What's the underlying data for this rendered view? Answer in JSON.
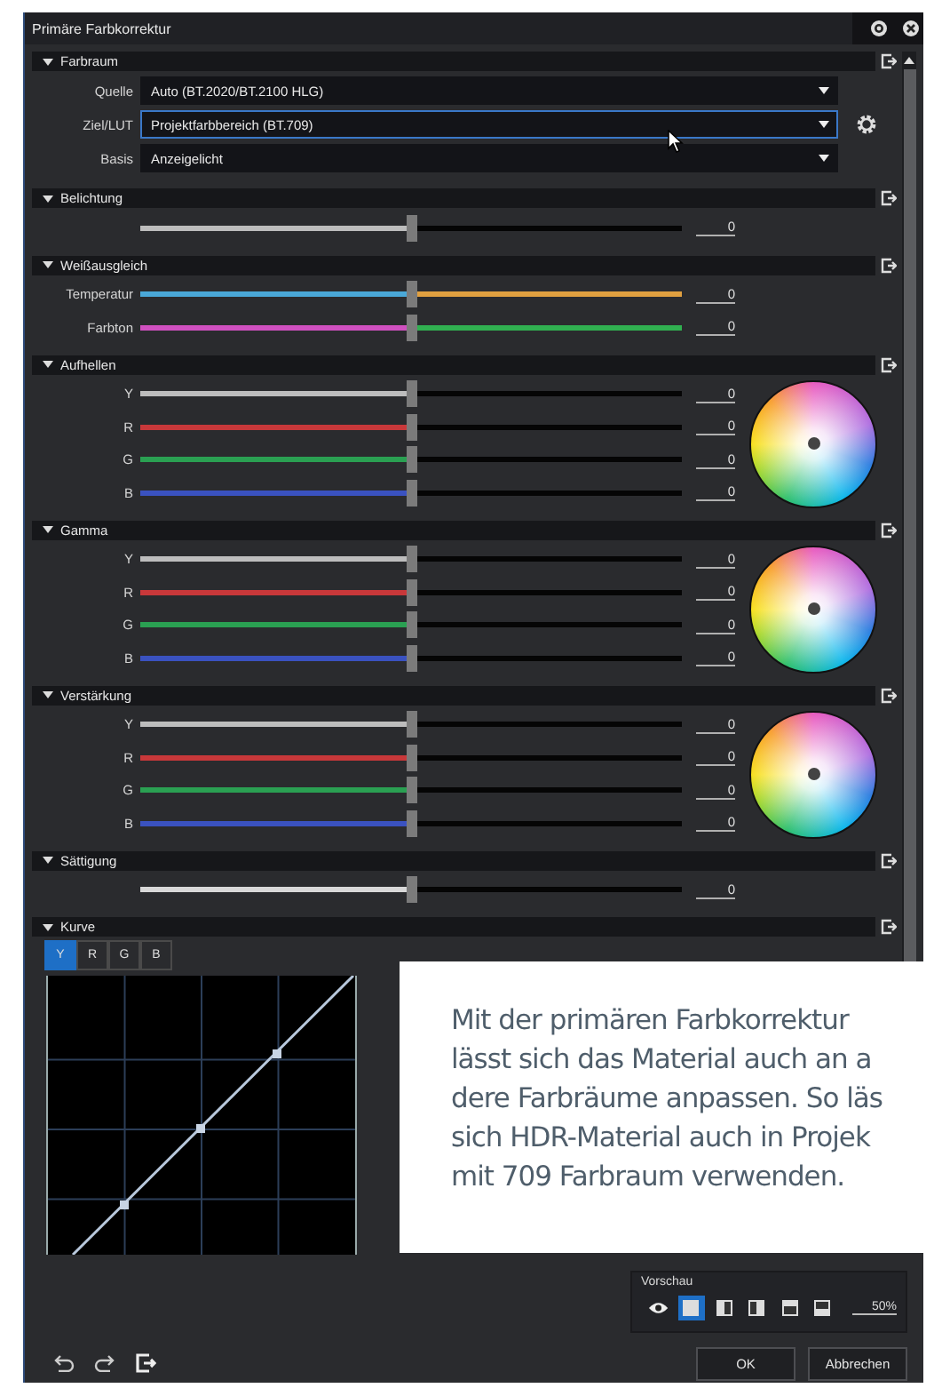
{
  "window": {
    "title": "Primäre Farbkorrektur"
  },
  "sections": [
    {
      "kind": "colorspace",
      "title": "Farbraum",
      "expanded": true,
      "fields": [
        {
          "label": "Quelle",
          "value": "Auto (BT.2020/BT.2100 HLG)",
          "focused": false,
          "settings_button": false
        },
        {
          "label": "Ziel/LUT",
          "value": "Projektfarbbereich (BT.709)",
          "focused": true,
          "settings_button": true
        },
        {
          "label": "Basis",
          "value": "Anzeigelicht",
          "focused": false,
          "settings_button": false
        }
      ]
    },
    {
      "kind": "sliders",
      "title": "Belichtung",
      "expanded": true,
      "wheel": false,
      "sliders": [
        {
          "color": "#bdbdbd",
          "level": 0.5,
          "value": "0"
        }
      ]
    },
    {
      "kind": "sliders",
      "title": "Weißausgleich",
      "expanded": true,
      "wheel": false,
      "sliders": [
        {
          "label": "Temperatur",
          "color": "#4aa8d8",
          "rail": {
            "color": "#e0a040"
          },
          "level": 0.5,
          "value": "0"
        },
        {
          "label": "Farbton",
          "color": "#d050c0",
          "rail": {
            "color": "#30b050"
          },
          "level": 0.5,
          "value": "0"
        }
      ]
    },
    {
      "kind": "sliders",
      "title": "Aufhellen",
      "expanded": true,
      "wheel": true,
      "sliders": [
        {
          "label": "Y",
          "color": "#bdbdbd",
          "level": 0.5,
          "value": "0"
        },
        {
          "label": "R",
          "color": "#c8383a",
          "level": 0.5,
          "value": "0"
        },
        {
          "label": "G",
          "color": "#2aa052",
          "level": 0.5,
          "value": "0"
        },
        {
          "label": "B",
          "color": "#3a52c0",
          "level": 0.5,
          "value": "0"
        }
      ]
    },
    {
      "kind": "sliders",
      "title": "Gamma",
      "expanded": true,
      "wheel": true,
      "sliders": [
        {
          "label": "Y",
          "color": "#bdbdbd",
          "level": 0.5,
          "value": "0"
        },
        {
          "label": "R",
          "color": "#c8383a",
          "level": 0.5,
          "value": "0"
        },
        {
          "label": "G",
          "color": "#2aa052",
          "level": 0.5,
          "value": "0"
        },
        {
          "label": "B",
          "color": "#3a52c0",
          "level": 0.5,
          "value": "0"
        }
      ]
    },
    {
      "kind": "sliders",
      "title": "Verstärkung",
      "expanded": true,
      "wheel": true,
      "sliders": [
        {
          "label": "Y",
          "color": "#bdbdbd",
          "level": 0.5,
          "value": "0"
        },
        {
          "label": "R",
          "color": "#c8383a",
          "level": 0.5,
          "value": "0"
        },
        {
          "label": "G",
          "color": "#2aa052",
          "level": 0.5,
          "value": "0"
        },
        {
          "label": "B",
          "color": "#3a52c0",
          "level": 0.5,
          "value": "0"
        }
      ]
    },
    {
      "kind": "sliders",
      "title": "Sättigung",
      "expanded": true,
      "wheel": false,
      "sliders": [
        {
          "color": "#d8d8d8",
          "level": 0.5,
          "value": "0"
        }
      ]
    },
    {
      "kind": "curve",
      "title": "Kurve",
      "expanded": true,
      "channels": [
        {
          "label": "Y",
          "selected": true
        },
        {
          "label": "R",
          "selected": false
        },
        {
          "label": "G",
          "selected": false
        },
        {
          "label": "B",
          "selected": false
        }
      ]
    }
  ],
  "preview": {
    "label": "Vorschau",
    "modes": [
      {
        "kind": "full",
        "selected": true
      },
      {
        "kind": "split-left",
        "selected": false
      },
      {
        "kind": "split-right",
        "selected": false
      },
      {
        "kind": "split-top",
        "selected": false
      },
      {
        "kind": "split-bottom",
        "selected": false
      }
    ],
    "zoom": "50%"
  },
  "buttons": [
    {
      "label": "OK"
    },
    {
      "label": "Abbrechen"
    }
  ],
  "caption": {
    "lines": [
      "Mit der primären Farbkorrektur",
      "lässt sich das Material auch an a",
      "dere Farbräume anpassen. So läs",
      "sich HDR-Material auch in Projek",
      "mit 709 Farbraum verwenden."
    ]
  }
}
